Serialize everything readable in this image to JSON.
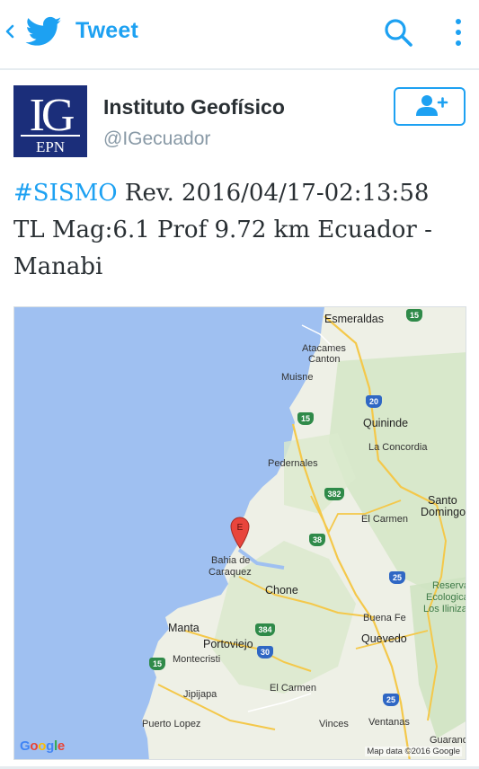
{
  "colors": {
    "accent": "#1da1f2",
    "text": "#292f33",
    "muted": "#8899a6",
    "ocean": "#9fc0f1",
    "land": "#eef0e6",
    "forest": "#cfe3c2"
  },
  "header": {
    "title": "Tweet",
    "back_icon": "chevron-left-icon",
    "logo_icon": "twitter-bird-icon",
    "search_icon": "search-icon",
    "more_icon": "more-vertical-icon"
  },
  "author": {
    "name": "Instituto Geofísico",
    "handle": "@IGecuador",
    "avatar_text_top": "IG",
    "avatar_text_bottom": "EPN",
    "follow_icon": "add-user-icon"
  },
  "tweet": {
    "hashtag": "#SISMO",
    "line1_rest": " Rev. 2016/04/17-02:13:58",
    "line2": "TL Mag:6.1 Prof 9.72 km Ecuador -",
    "line3": "Manabi"
  },
  "map": {
    "marker_label": "E",
    "places": {
      "esmeraldas": "Esmeraldas",
      "atacames": "Atacames",
      "canton": "Canton",
      "muisne": "Muisne",
      "quininde": "Quininde",
      "pedernales": "Pedernales",
      "la_concordia": "La Concordia",
      "santo": "Santo",
      "domingo": "Domingo",
      "el_carmen_n": "El Carmen",
      "bahia": "Bahia de",
      "caraquez": "Caraquez",
      "chone": "Chone",
      "reserva1": "Reserva",
      "reserva2": "Ecologica",
      "reserva3": "Los Ilinizas",
      "buena_fe": "Buena Fe",
      "manta": "Manta",
      "portoviejo": "Portoviejo",
      "quevedo": "Quevedo",
      "montecristi": "Montecristi",
      "jipijapa": "Jipijapa",
      "el_carmen_s": "El Carmen",
      "puerto_lopez": "Puerto Lopez",
      "vinces": "Vinces",
      "ventanas": "Ventanas",
      "guaranda": "Guaranda"
    },
    "shields": {
      "s15a": "15",
      "s20": "20",
      "s15b": "15",
      "s382": "382",
      "s38": "38",
      "s25a": "25",
      "s384": "384",
      "s30": "30",
      "s15c": "15",
      "s25b": "25"
    },
    "google": [
      "G",
      "o",
      "o",
      "g",
      "l",
      "e"
    ],
    "attribution": "Map data ©2016 Google"
  }
}
